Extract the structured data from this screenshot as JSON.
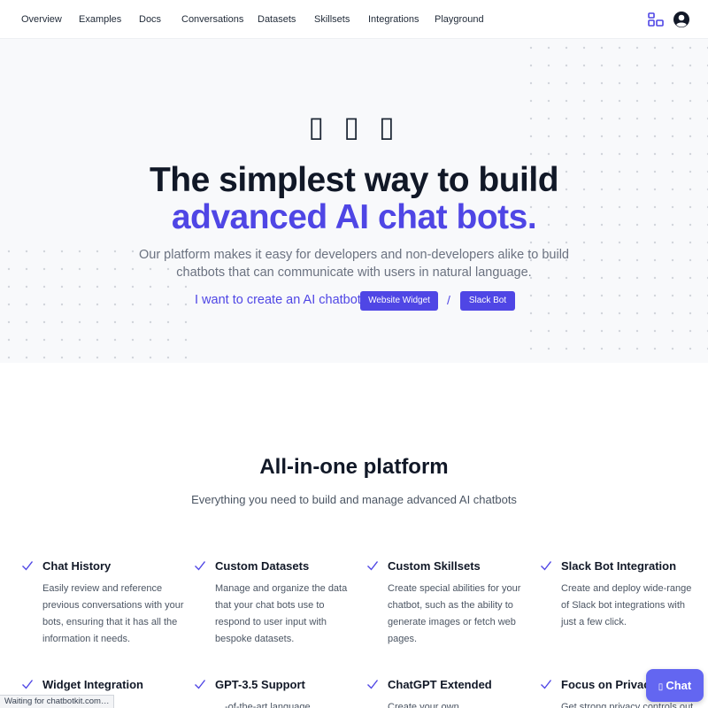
{
  "nav": {
    "links": [
      "Overview",
      "Examples",
      "Docs",
      "Conversations",
      "Datasets",
      "Skillsets",
      "Integrations",
      "Playground"
    ],
    "right_icons": [
      "layout-icon",
      "user-icon"
    ],
    "accent": "#4f46e5"
  },
  "hero": {
    "glyphs": "▯ ▯ ▯",
    "title_line1": "The simplest way to build",
    "title_line2": "advanced AI chat bots.",
    "subtitle": "Our platform makes it easy for developers and non-developers alike to build chatbots that can communicate with users in natural language.",
    "cta_text": "I want to create an AI chatbot",
    "cta_button_1": "Website Widget",
    "cta_slash": "/",
    "cta_button_2": "Slack Bot"
  },
  "features_section": {
    "title": "All-in-one platform",
    "subtitle": "Everything you need to build and manage advanced AI chatbots",
    "items": [
      {
        "title": "Chat History",
        "description": "Easily review and reference previous conversations with your bots, ensuring that it has all the information it needs."
      },
      {
        "title": "Custom Datasets",
        "description": "Manage and organize the data that your chat bots use to respond to user input with bespoke datasets."
      },
      {
        "title": "Custom Skillsets",
        "description": "Create special abilities for your chatbot, such as the ability to generate images or fetch web pages."
      },
      {
        "title": "Slack Bot Integration",
        "description": "Create and deploy wide-range of Slack bot integrations with just a few click."
      },
      {
        "title": "Widget Integration",
        "description": ""
      },
      {
        "title": "GPT-3.5 Support",
        "description": "…-of-the-art language"
      },
      {
        "title": "ChatGPT Extended",
        "description": "Create your own"
      },
      {
        "title": "Focus on Privacy",
        "description": "Get strong privacy controls out"
      }
    ]
  },
  "statusbar": {
    "text": "Waiting for chatbotkit.com…"
  },
  "chat_widget": {
    "label": "Chat",
    "icon": "chat-icon",
    "icon_glyph": "▯",
    "color": "#6366f1"
  }
}
